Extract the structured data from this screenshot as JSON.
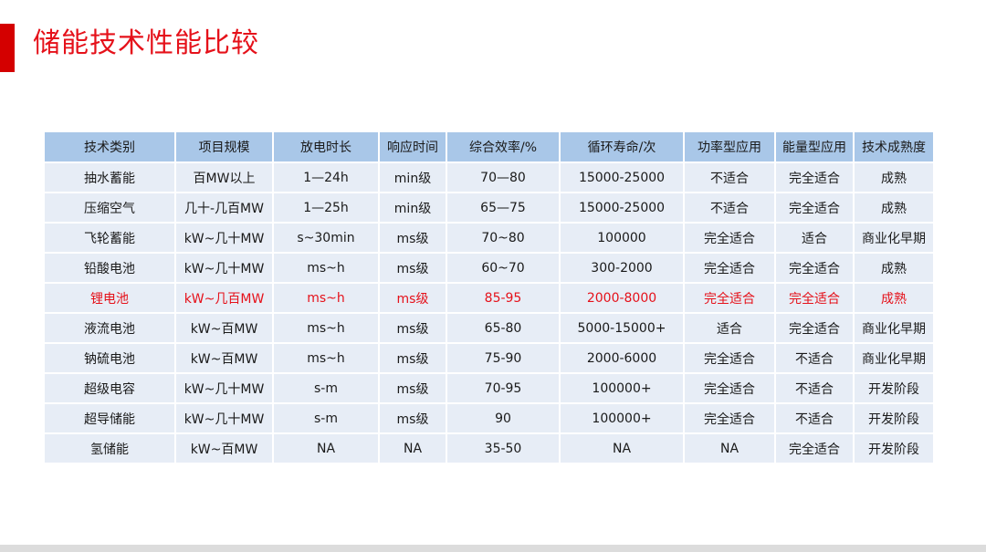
{
  "title": "储能技术性能比较",
  "colors": {
    "accent": "#d40000",
    "title": "#e5111a",
    "header_bg": "#a9c7e8",
    "cell_bg": "#e7edf6",
    "highlight_text": "#e5111a"
  },
  "table": {
    "headers": [
      "技术类别",
      "项目规模",
      "放电时长",
      "响应时间",
      "综合效率/%",
      "循环寿命/次",
      "功率型应用",
      "能量型应用",
      "技术成熟度"
    ],
    "rows": [
      [
        "抽水蓄能",
        "百MW以上",
        "1—24h",
        "min级",
        "70—80",
        "15000-25000",
        "不适合",
        "完全适合",
        "成熟"
      ],
      [
        "压缩空气",
        "几十-几百MW",
        "1—25h",
        "min级",
        "65—75",
        "15000-25000",
        "不适合",
        "完全适合",
        "成熟"
      ],
      [
        "飞轮蓄能",
        "kW~几十MW",
        "s~30min",
        "ms级",
        "70~80",
        "100000",
        "完全适合",
        "适合",
        "商业化早期"
      ],
      [
        "铅酸电池",
        "kW~几十MW",
        "ms~h",
        "ms级",
        "60~70",
        "300-2000",
        "完全适合",
        "完全适合",
        "成熟"
      ],
      [
        "锂电池",
        "kW~几百MW",
        "ms~h",
        "ms级",
        "85-95",
        "2000-8000",
        "完全适合",
        "完全适合",
        "成熟"
      ],
      [
        "液流电池",
        "kW~百MW",
        "ms~h",
        "ms级",
        "65-80",
        "5000-15000+",
        "适合",
        "完全适合",
        "商业化早期"
      ],
      [
        "钠硫电池",
        "kW~百MW",
        "ms~h",
        "ms级",
        "75-90",
        "2000-6000",
        "完全适合",
        "不适合",
        "商业化早期"
      ],
      [
        "超级电容",
        "kW~几十MW",
        "s-m",
        "ms级",
        "70-95",
        "100000+",
        "完全适合",
        "不适合",
        "开发阶段"
      ],
      [
        "超导储能",
        "kW~几十MW",
        "s-m",
        "ms级",
        "90",
        "100000+",
        "完全适合",
        "不适合",
        "开发阶段"
      ],
      [
        "氢储能",
        "kW~百MW",
        "NA",
        "NA",
        "35-50",
        "NA",
        "NA",
        "完全适合",
        "开发阶段"
      ]
    ],
    "highlight_row": 4
  }
}
